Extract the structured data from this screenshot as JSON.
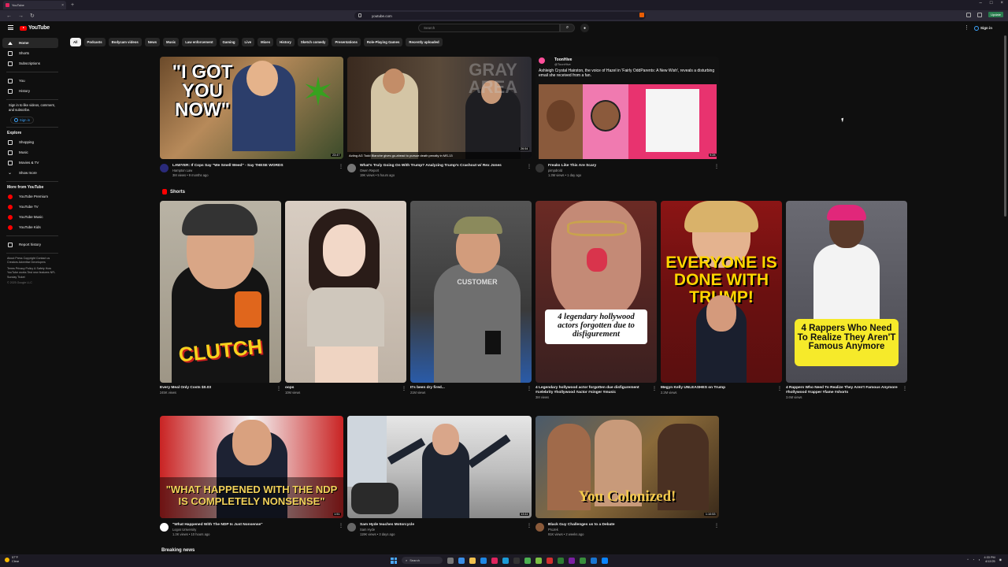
{
  "browser": {
    "tab_title": "YouTube",
    "new_tab": "+",
    "url": "youtube.com",
    "update_label": "Update"
  },
  "header": {
    "logo_text": "YouTube",
    "search_placeholder": "Search",
    "signin_label": "Sign in"
  },
  "sidebar": {
    "main_items": [
      {
        "label": "Home",
        "icon": "home-icon"
      },
      {
        "label": "Shorts",
        "icon": "shorts-icon"
      },
      {
        "label": "Subscriptions",
        "icon": "subscriptions-icon"
      },
      {
        "label": "You",
        "icon": "you-icon"
      },
      {
        "label": "History",
        "icon": "history-icon"
      }
    ],
    "signin_note": "Sign in to like videos, comment, and subscribe.",
    "signin_button": "Sign in",
    "explore_heading": "Explore",
    "explore_items": [
      {
        "label": "Shopping",
        "icon": "shopping-icon"
      },
      {
        "label": "Music",
        "icon": "music-icon"
      },
      {
        "label": "Movies & TV",
        "icon": "movies-icon"
      },
      {
        "label": "Show more",
        "icon": "chevron-down-icon"
      }
    ],
    "more_heading": "More from YouTube",
    "more_items": [
      {
        "label": "YouTube Premium"
      },
      {
        "label": "YouTube TV"
      },
      {
        "label": "YouTube Music"
      },
      {
        "label": "YouTube Kids"
      }
    ],
    "report_history": "Report history",
    "footer_1": "About  Press  Copyright  Contact us  Creators  Advertise  Developers",
    "footer_2": "Terms  Privacy  Policy & Safety  How YouTube works  Test new features  NFL Sunday Ticket",
    "copyright": "© 2025 Google LLC"
  },
  "chips": [
    "All",
    "Podcasts",
    "Bodycam videos",
    "News",
    "Music",
    "Law enforcement",
    "Gaming",
    "Live",
    "Mixes",
    "History",
    "Sketch comedy",
    "Presentations",
    "Role-Playing Games",
    "Recently uploaded"
  ],
  "row1": [
    {
      "title": "LAWYER: If Cops Say \"We Smell Weed\" - Say THESE WORDS",
      "channel": "Hampton Law",
      "stats": "3M views • 9 months ago",
      "duration": "23:47",
      "thumb_text": "\"I GOT YOU NOW\""
    },
    {
      "title": "What's Truly Going On With Trump? Analyzing Trump's Crashout w/ Rex Jones",
      "channel": "Owen Report",
      "stats": "19K views • 5 hours ago",
      "duration": "26:54",
      "caption": "Acting AG Todd Blanche gives go-ahead to pursue death penalty in MS-13",
      "thumb_text": "GRAY AREA"
    },
    {
      "title": "Freaks Like This Are Scary",
      "channel": "pimpdrold",
      "stats": "1.3M views • 1 day ago",
      "duration": "9:28",
      "post_name": "ToonHive",
      "post_handle": "@ToonHive",
      "post_text": "Ashleigh Crystal Hairston, the voice of Hazel in 'Fairly OddParents: A New Wish', reveals a disturbing email she received from a fan."
    }
  ],
  "shorts_heading": "Shorts",
  "shorts": [
    {
      "title": "Every Meal Only Costs $0.03",
      "views": "245K views",
      "overlay": "CLUTCH"
    },
    {
      "title": "oops",
      "views": "10M views",
      "overlay": ""
    },
    {
      "title": "It's been dry fired...",
      "views": "21M views",
      "overlay": "CUSTOMER"
    },
    {
      "title": "4 Legendary hollywood actor forgotten due disfigurement #celebrity #hollywood #actor #singer #music",
      "views": "3M views",
      "overlay": "4 legendary hollywood actors forgotten due to disfigurement"
    },
    {
      "title": "Megyn Kelly UNLEASHES on Trump",
      "views": "2.2M views",
      "overlay": "EVERYONE IS DONE WITH TRUMP!"
    },
    {
      "title": "4 Rappers Who Need To Realize They Aren't Famous Anymore #hollywood #rapper #fame #shorts",
      "views": "3.6M views",
      "overlay": "4 Rappers Who Need To Realize They Aren'T Famous Anymore"
    }
  ],
  "row3": [
    {
      "title": "\"What Happened With The NDP Is Just Nonsense\"",
      "channel": "Logos University",
      "stats": "1.3K views • 10 hours ago",
      "duration": "1:51",
      "thumb_text": "\"WHAT HAPPENED WITH THE NDP IS COMPLETELY NONSENSE\""
    },
    {
      "title": "Sam Hyde teaches Motorcycle",
      "channel": "Sam Hyde",
      "stats": "119K views • 3 days ago",
      "duration": "13:11"
    },
    {
      "title": "Black Guy Challenges us to a Debate",
      "channel": "ProJek",
      "stats": "91K views • 2 weeks ago",
      "duration": "1:10:53",
      "thumb_text": "You Colonized!"
    }
  ],
  "breaking_news": "Breaking news",
  "taskbar": {
    "weather_temp": "57°F",
    "weather_desc": "Clear",
    "search_label": "Search",
    "time": "4:33 PM",
    "date": "4/12/25"
  }
}
